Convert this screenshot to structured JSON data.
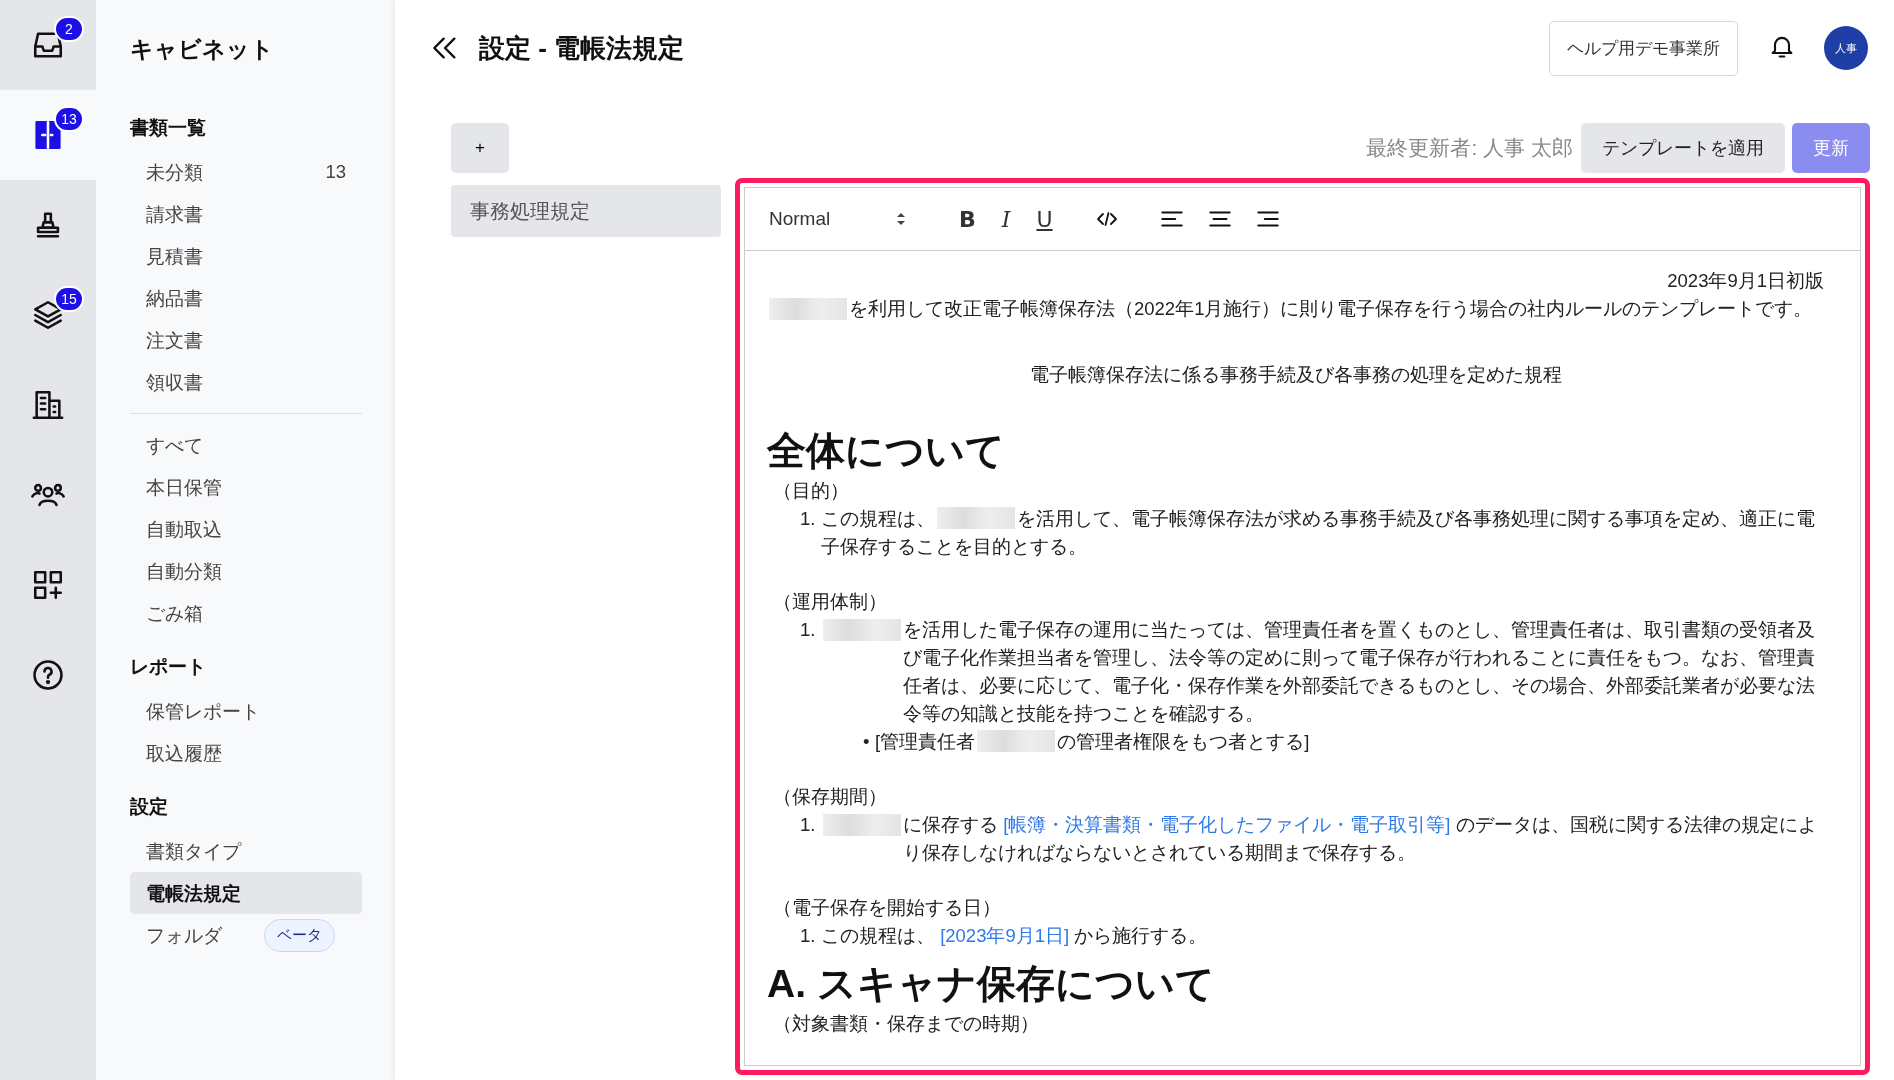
{
  "rail": [
    {
      "badge": "2",
      "selected": false
    },
    {
      "badge": "13",
      "selected": true
    },
    {
      "selected": false
    },
    {
      "badge": "15",
      "selected": false
    },
    {
      "selected": false
    },
    {
      "selected": false
    },
    {
      "selected": false
    },
    {
      "selected": false
    }
  ],
  "sidebar": {
    "title": "キャビネット",
    "sections": [
      {
        "heading": "書類一覧",
        "items": [
          {
            "label": "未分類",
            "count": "13",
            "selected": false
          },
          {
            "label": "請求書",
            "selected": false
          },
          {
            "label": "見積書",
            "selected": false
          },
          {
            "label": "納品書",
            "selected": false
          },
          {
            "label": "注文書",
            "selected": false
          },
          {
            "label": "領収書",
            "selected": false
          }
        ]
      },
      {
        "items": [
          {
            "label": "すべて",
            "selected": false
          },
          {
            "label": "本日保管",
            "selected": false
          },
          {
            "label": "自動取込",
            "selected": false
          },
          {
            "label": "自動分類",
            "selected": false
          },
          {
            "label": "ごみ箱",
            "selected": false
          }
        ]
      },
      {
        "heading": "レポート",
        "items": [
          {
            "label": "保管レポート",
            "selected": false
          },
          {
            "label": "取込履歴",
            "selected": false
          }
        ]
      },
      {
        "heading": "設定",
        "items": [
          {
            "label": "書類タイプ",
            "selected": false
          },
          {
            "label": "電帳法規定",
            "selected": true
          },
          {
            "label": "フォルダ",
            "tag": "ベータ",
            "selected": false
          }
        ]
      }
    ]
  },
  "header": {
    "title": "設定 - 電帳法規定",
    "office": "ヘルプ用デモ事業所",
    "avatar": "人事"
  },
  "templates": {
    "add": "+",
    "items": [
      {
        "label": "事務処理規定",
        "selected": true
      }
    ]
  },
  "editor": {
    "updated_by": "最終更新者: 人事 太郎",
    "apply_button": "テンプレートを適用",
    "update_button": {
      "label": "更新",
      "disabled": true
    },
    "toolbar": [
      {
        "kind": "select",
        "label": "Normal"
      },
      {
        "kind": "bold",
        "label": "B"
      },
      {
        "kind": "italic",
        "label": "I"
      },
      {
        "kind": "underline",
        "label": "U"
      },
      {
        "kind": "code"
      },
      {
        "kind": "align-left"
      },
      {
        "kind": "align-center"
      },
      {
        "kind": "align-right"
      }
    ],
    "blocks": [
      {
        "kind": "right",
        "parts": [
          {
            "text": "2023年9月1日初版"
          }
        ]
      },
      {
        "kind": "para",
        "parts": [
          {
            "kind": "redacted"
          },
          {
            "text": "を利用して改正電子帳簿保存法（2022年1月施行）に則り電子保存を行う場合の社内ルールのテンプレートです。"
          }
        ]
      },
      {
        "kind": "center",
        "parts": [
          {
            "text": "電子帳簿保存法に係る事務手続及び各事務の処理を定めた規程"
          }
        ]
      },
      {
        "kind": "h1",
        "parts": [
          {
            "text": "全体について"
          }
        ]
      },
      {
        "kind": "label",
        "parts": [
          {
            "text": "（目的）"
          }
        ]
      },
      {
        "kind": "item",
        "marker": "1.",
        "parts": [
          {
            "text": "この規程は、"
          },
          {
            "kind": "redacted"
          },
          {
            "text": "を活用して、電子帳簿保存法が求める事務手続及び各事務処理に関する事項を定め、適正に電子保存することを目的とする。"
          }
        ]
      },
      {
        "kind": "label",
        "parts": [
          {
            "text": "（運用体制）"
          }
        ]
      },
      {
        "kind": "item",
        "marker": "1.",
        "parts": [
          {
            "kind": "redacted"
          },
          {
            "text": "を活用した電子保存の運用に当たっては、管理責任者を置くものとし、管理責任者は、取引書類の受領者及び電子化作業担当者を管理し、法令等の定めに則って電子保存が行われることに責任をもつ。なお、管理責任者は、必要に応じて、電子化・保存作業を外部委託できるものとし、その場合、外部委託業者が必要な法令等の知識と技能を持つことを確認する。"
          }
        ]
      },
      {
        "kind": "bullet",
        "marker": "•",
        "parts": [
          {
            "text": "[管理責任者"
          },
          {
            "kind": "redacted"
          },
          {
            "text": "の管理者権限をもつ者とする]"
          }
        ]
      },
      {
        "kind": "label",
        "parts": [
          {
            "text": "（保存期間）"
          }
        ]
      },
      {
        "kind": "item",
        "marker": "1.",
        "parts": [
          {
            "kind": "redacted"
          },
          {
            "text": "に保存する "
          },
          {
            "kind": "link",
            "text": "[帳簿・決算書類・電子化したファイル・電子取引等]"
          },
          {
            "text": " のデータは、国税に関する法律の規定により保存しなければならないとされている期間まで保存する。"
          }
        ]
      },
      {
        "kind": "label",
        "parts": [
          {
            "text": "（電子保存を開始する日）"
          }
        ]
      },
      {
        "kind": "item",
        "marker": "1.",
        "parts": [
          {
            "text": "この規程は、 "
          },
          {
            "kind": "link",
            "text": "[2023年9月1日]"
          },
          {
            "text": " から施行する。"
          }
        ]
      },
      {
        "kind": "h1",
        "parts": [
          {
            "text": "A. スキャナ保存について"
          }
        ]
      },
      {
        "kind": "label",
        "parts": [
          {
            "text": "（対象書類・保存までの時期）"
          }
        ]
      }
    ]
  }
}
